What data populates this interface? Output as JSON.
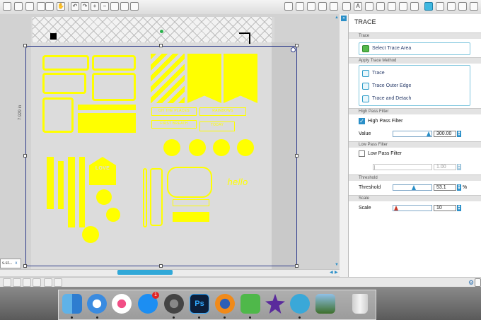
{
  "document_tab": {
    "label": "s.st...",
    "close": "x"
  },
  "ruler": {
    "height_label": "7.929 in"
  },
  "design": {
    "labels": [
      "OH THE PLACES",
      "RAINBOWS",
      "FIRST BREATH",
      "TODAY",
      "LOVE",
      "hello"
    ]
  },
  "panel": {
    "title": "TRACE",
    "sections": {
      "trace": "Trace",
      "method": "Apply Trace Method",
      "high_pass": "High Pass Filter",
      "low_pass": "Low Pass Filter",
      "threshold": "Threshold",
      "scale": "Scale"
    },
    "select_trace_area": "Select Trace Area",
    "trace": "Trace",
    "trace_outer_edge": "Trace Outer Edge",
    "trace_and_detach": "Trace and Detach",
    "high_pass_checkbox": "High Pass Filter",
    "high_pass_checked": true,
    "value_label": "Value",
    "high_pass_value": "300.00",
    "low_pass_checkbox": "Low Pass Filter",
    "low_pass_checked": false,
    "low_pass_value": "1.00",
    "threshold_label": "Threshold",
    "threshold_value": "53.1",
    "threshold_unit": "%",
    "scale_label": "Scale",
    "scale_value": "10"
  },
  "dock": {
    "apps": [
      "finder",
      "safari",
      "itunes",
      "app-store",
      "system-preferences",
      "photoshop",
      "firefox",
      "evernote",
      "imovie",
      "silhouette-studio",
      "preview",
      "trash"
    ],
    "app_store_badge": "1"
  },
  "colors": {
    "accent": "#30a8d8",
    "design": "#ffff00",
    "selection": "#2d3a8a"
  }
}
